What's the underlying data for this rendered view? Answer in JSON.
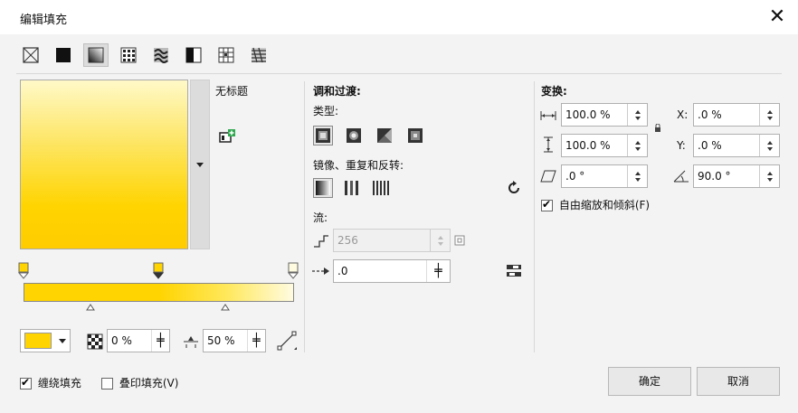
{
  "window": {
    "title": "编辑填充"
  },
  "fill_types": [
    {
      "icon": "no-fill-icon"
    },
    {
      "icon": "uniform-fill-icon"
    },
    {
      "icon": "fountain-fill-icon",
      "selected": true
    },
    {
      "icon": "vector-pattern-fill-icon"
    },
    {
      "icon": "bitmap-pattern-fill-icon"
    },
    {
      "icon": "two-color-pattern-fill-icon"
    },
    {
      "icon": "texture-fill-icon"
    },
    {
      "icon": "postscript-fill-icon"
    }
  ],
  "preview": {
    "name": "无标题"
  },
  "gradient": {
    "start_color": "#ffd400",
    "end_color": "#fffbe0",
    "node_color": "#ffd400",
    "node_opacity": "0 %",
    "node_position": "50 %"
  },
  "blend": {
    "heading": "调和过渡:",
    "type_label": "类型:",
    "mirror_label": "镜像、重复和反转:",
    "steps_label": "流:",
    "steps_value": "256",
    "accel_value": ".0"
  },
  "transform": {
    "heading": "变换:",
    "width": "100.0 %",
    "height": "100.0 %",
    "skew": ".0 °",
    "x_label": "X:",
    "x_value": ".0 %",
    "y_label": "Y:",
    "y_value": ".0 %",
    "rotate": "90.0 °",
    "free_scale_label": "自由缩放和倾斜(F)",
    "free_scale_checked": true
  },
  "footer": {
    "wrap_fill_label": "缠绕填充",
    "wrap_fill_checked": true,
    "overprint_label": "叠印填充(V)",
    "overprint_checked": false,
    "ok_label": "确定",
    "cancel_label": "取消"
  }
}
